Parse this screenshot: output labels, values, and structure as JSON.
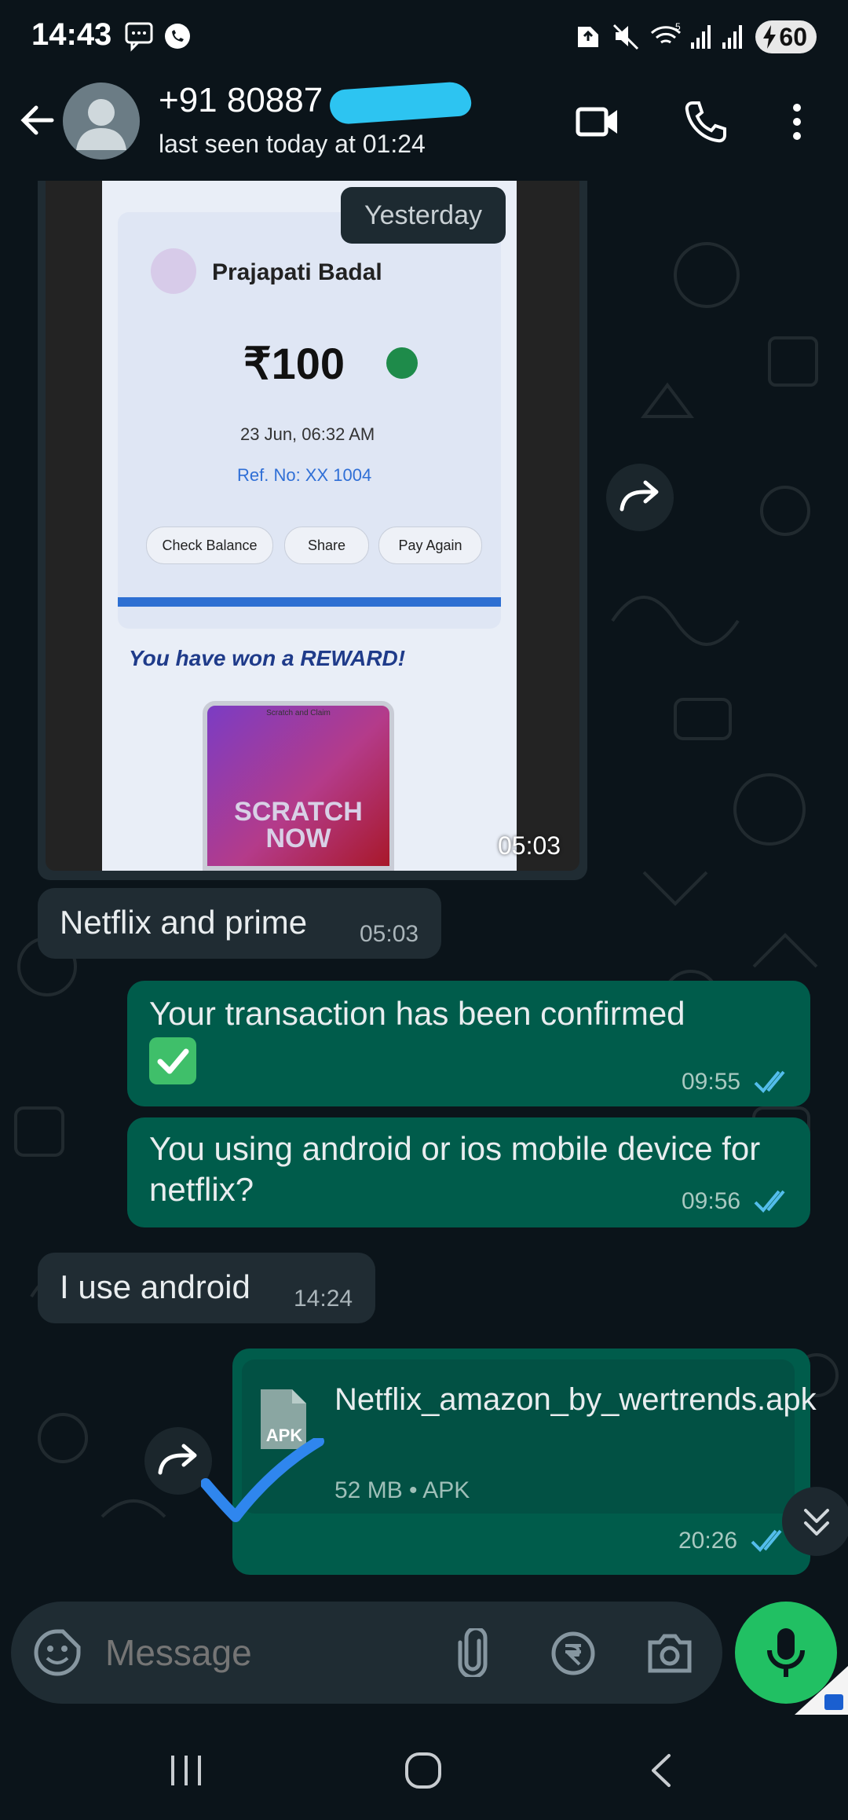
{
  "status_bar": {
    "time": "14:43",
    "battery": "60",
    "icons": [
      "chat-notification-icon",
      "whatsapp-notification-icon",
      "nfc-icon",
      "mute-icon",
      "wifi-5g-icon",
      "signal-icon",
      "signal-icon",
      "battery-charging-icon"
    ]
  },
  "header": {
    "contact_name": "+91 80887",
    "last_seen": "last seen today at 01:24",
    "icons": [
      "back-arrow-icon",
      "avatar",
      "video-call-icon",
      "phone-call-icon",
      "more-vert-icon"
    ]
  },
  "chat": {
    "date_chip": "Yesterday",
    "image_message": {
      "time": "05:03",
      "photo_content": {
        "payee": "Prajapati Badal",
        "amount": "₹100",
        "date": "23 Jun, 06:32 AM",
        "ref": "Ref. No: XX 1004",
        "buttons": [
          "Check Balance",
          "Share",
          "Pay Again"
        ],
        "reward": "You have won a REWARD!",
        "scratch_top": "Scratch and Claim",
        "scratch_line1": "SCRATCH",
        "scratch_line2": "NOW"
      }
    },
    "messages": [
      {
        "direction": "in",
        "text": "Netflix and prime",
        "time": "05:03"
      },
      {
        "direction": "out",
        "text": "Your transaction has been confirmed",
        "emoji": "✅",
        "time": "09:55",
        "read": true
      },
      {
        "direction": "out",
        "text": "You using android or ios mobile device for netflix?",
        "time": "09:56",
        "read": true
      },
      {
        "direction": "in",
        "text": "I use android",
        "time": "14:24"
      }
    ],
    "file_message": {
      "direction": "out",
      "file_name": "Netflix_amazon_by_wertrends.apk",
      "file_icon_label": "APK",
      "meta": "52 MB • APK",
      "time": "20:26",
      "read": true
    }
  },
  "composer": {
    "placeholder": "Message",
    "icons": [
      "emoji-sticker-icon",
      "attach-icon",
      "rupee-payment-icon",
      "camera-icon",
      "mic-icon"
    ]
  },
  "colors": {
    "background": "#0b141a",
    "incoming_bubble": "#202c33",
    "outgoing_bubble": "#005c4b",
    "read_tick": "#53bdeb",
    "mic_button": "#21c063"
  }
}
